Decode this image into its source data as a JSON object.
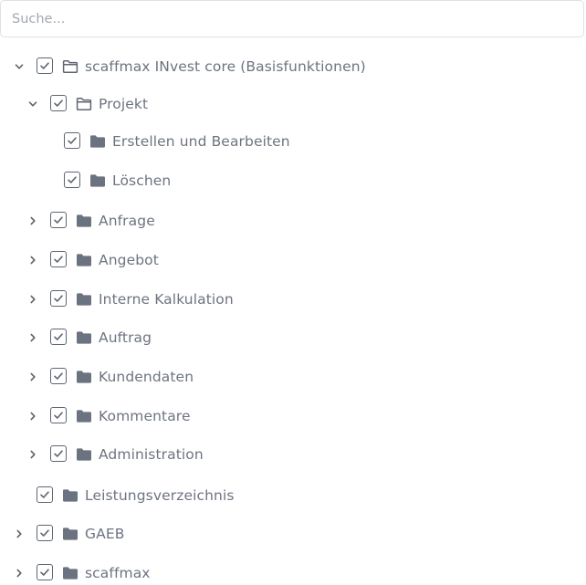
{
  "search": {
    "placeholder": "Suche..."
  },
  "tree": [
    {
      "label": "scaffmax INvest core (Basisfunktionen)",
      "level": 0,
      "expander": "expanded",
      "checked": true,
      "folder": "open"
    },
    {
      "label": "Projekt",
      "level": 1,
      "expander": "expanded",
      "checked": true,
      "folder": "open"
    },
    {
      "label": "Erstellen und Bearbeiten",
      "level": 2,
      "expander": "none",
      "checked": true,
      "folder": "closed"
    },
    {
      "label": "Löschen",
      "level": 2,
      "expander": "none",
      "checked": true,
      "folder": "closed"
    },
    {
      "label": "Anfrage",
      "level": 1,
      "expander": "collapsed",
      "checked": true,
      "folder": "closed"
    },
    {
      "label": "Angebot",
      "level": 1,
      "expander": "collapsed",
      "checked": true,
      "folder": "closed"
    },
    {
      "label": "Interne Kalkulation",
      "level": 1,
      "expander": "collapsed",
      "checked": true,
      "folder": "closed"
    },
    {
      "label": "Auftrag",
      "level": 1,
      "expander": "collapsed",
      "checked": true,
      "folder": "closed"
    },
    {
      "label": "Kundendaten",
      "level": 1,
      "expander": "collapsed",
      "checked": true,
      "folder": "closed"
    },
    {
      "label": "Kommentare",
      "level": 1,
      "expander": "collapsed",
      "checked": true,
      "folder": "closed"
    },
    {
      "label": "Administration",
      "level": 1,
      "expander": "collapsed",
      "checked": true,
      "folder": "closed"
    },
    {
      "label": "Leistungsverzeichnis",
      "level": 0,
      "expander": "none",
      "checked": true,
      "folder": "closed"
    },
    {
      "label": "GAEB",
      "level": 0,
      "expander": "collapsed",
      "checked": true,
      "folder": "closed"
    },
    {
      "label": "scaffmax",
      "level": 0,
      "expander": "collapsed",
      "checked": true,
      "folder": "closed"
    }
  ],
  "colors": {
    "text": "#6d7480",
    "icon": "#5f6571",
    "folder_fill": "#6b7280",
    "border": "#dfe1e6"
  }
}
